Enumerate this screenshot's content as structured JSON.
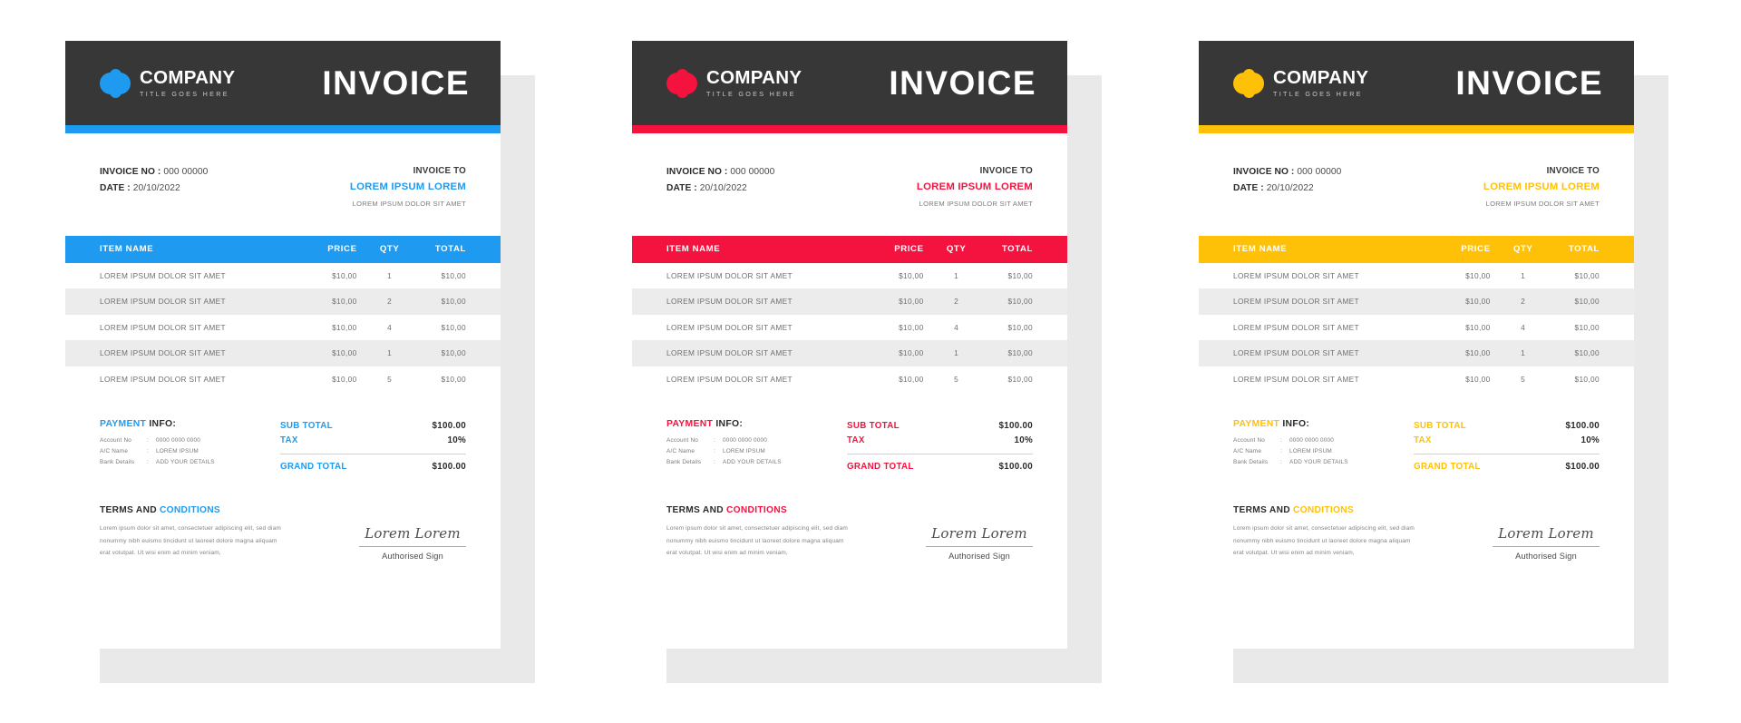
{
  "page": {
    "background": "#ffffff",
    "card_count": 3
  },
  "shared": {
    "header": {
      "brand_name": "COMPANY",
      "brand_tagline": "TITLE GOES HERE",
      "title": "INVOICE",
      "bg_color": "#373737",
      "logo_icon": "company-ellipse-logo-icon"
    },
    "meta": {
      "invoice_no_label": "INVOICE NO :",
      "invoice_no_value": "000 00000",
      "date_label": "DATE :",
      "date_value": "20/10/2022",
      "invoice_to_label": "INVOICE TO",
      "client_name": "LOREM IPSUM LOREM",
      "client_address": "LOREM IPSUM DOLOR SIT AMET"
    },
    "table": {
      "columns": [
        "ITEM NAME",
        "PRICE",
        "QTY",
        "TOTAL"
      ],
      "rows": [
        {
          "item": "LOREM IPSUM DOLOR SIT AMET",
          "price": "$10,00",
          "qty": "1",
          "total": "$10,00"
        },
        {
          "item": "LOREM IPSUM DOLOR SIT AMET",
          "price": "$10,00",
          "qty": "2",
          "total": "$10,00"
        },
        {
          "item": "LOREM IPSUM DOLOR SIT AMET",
          "price": "$10,00",
          "qty": "4",
          "total": "$10,00"
        },
        {
          "item": "LOREM IPSUM DOLOR SIT AMET",
          "price": "$10,00",
          "qty": "1",
          "total": "$10,00"
        },
        {
          "item": "LOREM IPSUM DOLOR SIT AMET",
          "price": "$10,00",
          "qty": "5",
          "total": "$10,00"
        }
      ],
      "alt_row_color": "#ececec"
    },
    "payment": {
      "title_accent": "PAYMENT",
      "title_rest": "INFO:",
      "details": [
        {
          "key": "Account No",
          "value": "0000 0000 0000"
        },
        {
          "key": "A/C Name",
          "value": "LOREM IPSUM"
        },
        {
          "key": "Bank Details",
          "value": "ADD YOUR DETAILS"
        }
      ]
    },
    "totals": {
      "sub_total_label": "SUB TOTAL",
      "sub_total_value": "$100.00",
      "tax_label": "TAX",
      "tax_value": "10%",
      "grand_total_label": "GRAND TOTAL",
      "grand_total_value": "$100.00"
    },
    "terms": {
      "head_plain": "TERMS AND ",
      "head_accent": "CONDITIONS",
      "body": "Lorem ipsum dolor sit amet, consectetuer adipiscing elit, sed diam nonummy nibh euismo tincidunt ut laoreet dolore magna aliquam erat volutpat. Ut wisi enim ad minim veniam,",
      "signature_script": "Lorem Lorem",
      "signature_label": "Authorised Sign"
    }
  },
  "cards": [
    {
      "id": "invoice-blue",
      "accent": "#1e9bf0",
      "accent_name": "blue"
    },
    {
      "id": "invoice-red",
      "accent": "#f4133f",
      "accent_name": "red"
    },
    {
      "id": "invoice-yellow",
      "accent": "#ffc107",
      "accent_name": "yellow"
    }
  ]
}
